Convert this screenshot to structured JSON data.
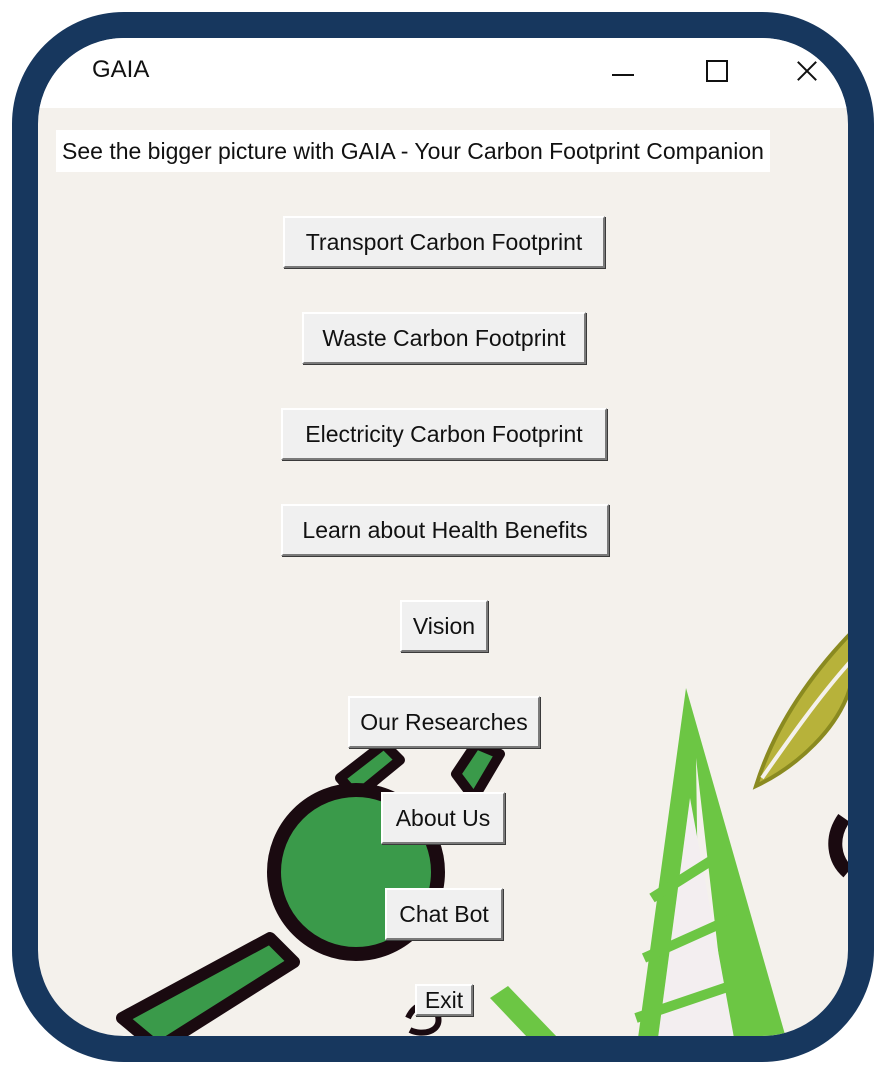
{
  "window": {
    "title": "GAIA"
  },
  "banner": {
    "text": "See the bigger picture with GAIA - Your Carbon Footprint Companion"
  },
  "menu": {
    "transport": "Transport Carbon Footprint",
    "waste": "Waste Carbon Footprint",
    "electricity": "Electricity Carbon Footprint",
    "health": "Learn about Health Benefits",
    "vision": "Vision",
    "research": "Our Researches",
    "about": "About Us",
    "chatbot": "Chat Bot",
    "exit": "Exit"
  },
  "colors": {
    "frame": "#17375e",
    "background": "#f4f1ec",
    "button": "#f0f0f0",
    "leaf_green": "#6cc644",
    "dark_green": "#3a9a4a",
    "olive": "#b7b23a"
  }
}
